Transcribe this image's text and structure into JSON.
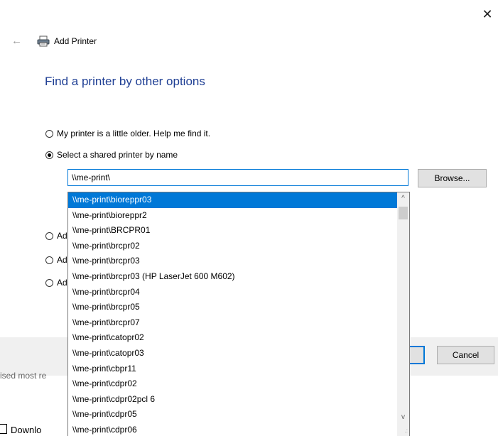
{
  "window": {
    "title": "Add Printer",
    "close_glyph": "✕",
    "back_glyph": "←",
    "heading": "Find a printer by other options"
  },
  "options": [
    {
      "label": "My printer is a little older. Help me find it.",
      "checked": false
    },
    {
      "label": "Select a shared printer by name",
      "checked": true
    },
    {
      "label": "Add",
      "checked": false
    },
    {
      "label": "Add",
      "checked": false
    },
    {
      "label": "Add",
      "checked": false
    }
  ],
  "input": {
    "value": "\\\\me-print\\"
  },
  "buttons": {
    "browse": "Browse...",
    "cancel": "Cancel"
  },
  "background": {
    "used_text": "ised most re",
    "download_text": "Downlo"
  },
  "dropdown": {
    "items": [
      "\\\\me-print\\bioreppr03",
      "\\\\me-print\\bioreppr2",
      "\\\\me-print\\BRCPR01",
      "\\\\me-print\\brcpr02",
      "\\\\me-print\\brcpr03",
      "\\\\me-print\\brcpr03 (HP LaserJet 600 M602)",
      "\\\\me-print\\brcpr04",
      "\\\\me-print\\brcpr05",
      "\\\\me-print\\brcpr07",
      "\\\\me-print\\catopr02",
      "\\\\me-print\\catopr03",
      "\\\\me-print\\cbpr11",
      "\\\\me-print\\cdpr02",
      "\\\\me-print\\cdpr02pcl 6",
      "\\\\me-print\\cdpr05",
      "\\\\me-print\\cdpr06"
    ],
    "selected_index": 0,
    "scroll_up_glyph": "^",
    "scroll_down_glyph": "v",
    "grip_glyph": ".:"
  },
  "icons": {
    "printer": "printer-icon",
    "close": "close-icon",
    "back": "back-arrow-icon"
  },
  "colors": {
    "accent": "#0078d7",
    "heading": "#1f3f94"
  }
}
